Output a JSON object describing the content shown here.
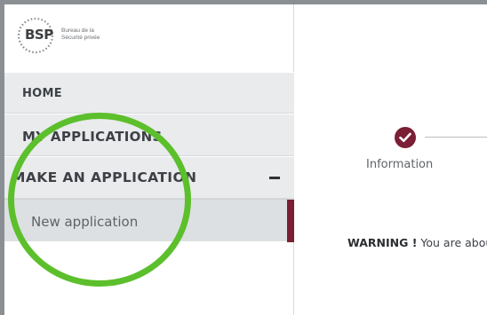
{
  "logo": {
    "abbreviation": "BSP",
    "line1": "Bureau de la",
    "line2": "Sécurité privée"
  },
  "nav": {
    "home": "HOME",
    "my_applications": "MY APPLICATIONS",
    "make_application": "MAKE AN APPLICATION",
    "make_application_toggle": "−",
    "new_application": "New application"
  },
  "steps": [
    {
      "label": "Information",
      "status": "completed",
      "icon": "check-icon"
    }
  ],
  "warning": {
    "label": "WARNING !",
    "text": "You are about to"
  },
  "colors": {
    "accent": "#7a1f35",
    "highlight_circle": "#5cbf2c",
    "nav_bg": "#e9ebec",
    "nav_sub_bg": "#dde0e2"
  }
}
